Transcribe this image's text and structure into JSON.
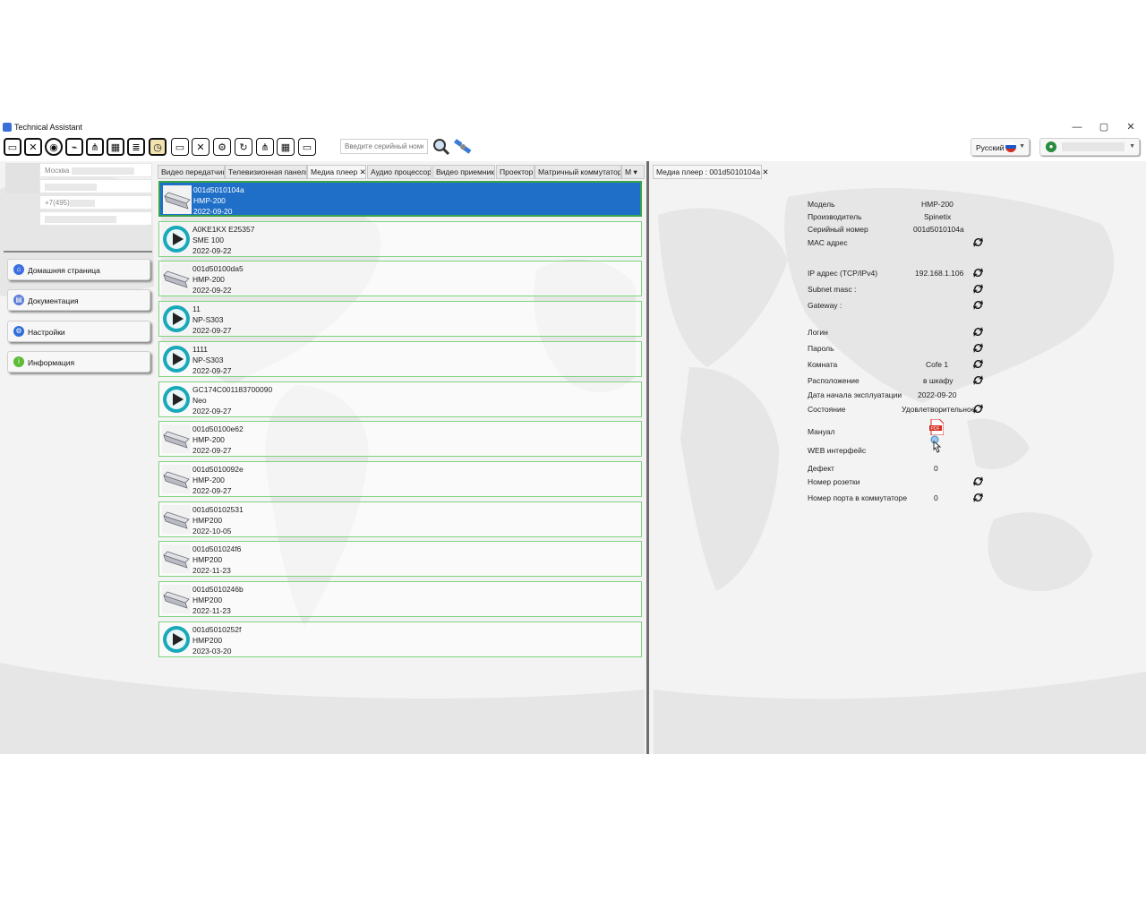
{
  "window": {
    "title": "Technical Assistant",
    "controls": {
      "minimize": "—",
      "maximize": "▢",
      "close": "✕"
    }
  },
  "toolbar": {
    "search_placeholder": "Введите серийный номе",
    "language": "Русский",
    "icons": [
      "display-icon",
      "tools-icon",
      "projector-icon",
      "cable-icon",
      "network-icon",
      "calendar-icon",
      "document-icon",
      "clock-icon",
      "monitor-search-icon",
      "monitor-tools-icon",
      "monitor-settings-icon",
      "monitor-refresh-icon",
      "monitor-network-icon",
      "monitor-calendar-icon",
      "monitor-doc-icon"
    ]
  },
  "left": {
    "fields": [
      "Москва",
      "",
      "+7(495)",
      ""
    ],
    "nav": [
      {
        "label": "Домашняя страница",
        "icon": "home-icon",
        "color": "#3b6fe0"
      },
      {
        "label": "Документация",
        "icon": "document-icon",
        "color": "#5a7bd8"
      },
      {
        "label": "Настройки",
        "icon": "gear-icon",
        "color": "#2f6fd6"
      },
      {
        "label": "Информация",
        "icon": "info-icon",
        "color": "#5dbb3a"
      }
    ]
  },
  "tabs": [
    {
      "label": "Видео передатчик"
    },
    {
      "label": "Телевизионная панель"
    },
    {
      "label": "Медиа плеер ✕",
      "active": true
    },
    {
      "label": "Аудио процессор"
    },
    {
      "label": "Видео приемник"
    },
    {
      "label": "Проектор"
    },
    {
      "label": "Матричный коммутатор"
    },
    {
      "label": "М ▾"
    }
  ],
  "devices": [
    {
      "serial": "001d5010104a",
      "model": "HMP-200",
      "date": "2022-09-20",
      "thumb": "player",
      "selected": true
    },
    {
      "serial": "A0KE1KX E25357",
      "model": "SME 100",
      "date": "2022-09-22",
      "thumb": "play"
    },
    {
      "serial": "001d50100da5",
      "model": "HMP-200",
      "date": "2022-09-22",
      "thumb": "player"
    },
    {
      "serial": "11",
      "model": "NP-S303",
      "date": "2022-09-27",
      "thumb": "play"
    },
    {
      "serial": "1111",
      "model": "NP-S303",
      "date": "2022-09-27",
      "thumb": "play"
    },
    {
      "serial": "GC174C001183700090",
      "model": "Neo",
      "date": "2022-09-27",
      "thumb": "play"
    },
    {
      "serial": "001d50100e62",
      "model": "HMP-200",
      "date": "2022-09-27",
      "thumb": "player"
    },
    {
      "serial": "001d5010092e",
      "model": "HMP-200",
      "date": "2022-09-27",
      "thumb": "player"
    },
    {
      "serial": "001d50102531",
      "model": "HMP200",
      "date": "2022-10-05",
      "thumb": "player"
    },
    {
      "serial": "001d501024f6",
      "model": "HMP200",
      "date": "2022-11-23",
      "thumb": "player"
    },
    {
      "serial": "001d5010246b",
      "model": "HMP200",
      "date": "2022-11-23",
      "thumb": "player"
    },
    {
      "serial": "001d5010252f",
      "model": "HMP200",
      "date": "2023-03-20",
      "thumb": "play"
    }
  ],
  "detail": {
    "tab": "Медиа плеер : 001d5010104a ✕",
    "rows": [
      {
        "label": "Модель",
        "value": "HMP-200",
        "sync": false
      },
      {
        "label": "Производитель",
        "value": "Spinetix",
        "sync": false
      },
      {
        "label": "Серийный номер",
        "value": "001d5010104a",
        "sync": false
      },
      {
        "label": "MAC адрес",
        "value": "",
        "sync": true
      },
      {
        "label": "IP адрес (TCP/IPv4)",
        "value": "192.168.1.106",
        "sync": true
      },
      {
        "label": "Subnet masc :",
        "value": "",
        "sync": true
      },
      {
        "label": "Gateway :",
        "value": "",
        "sync": true
      },
      {
        "label": "Логин",
        "value": "",
        "sync": true
      },
      {
        "label": "Пароль",
        "value": "",
        "sync": true
      },
      {
        "label": "Комната",
        "value": "Cofe 1",
        "sync": true
      },
      {
        "label": "Расположение",
        "value": "в шкафу",
        "sync": true
      },
      {
        "label": "Дата начала эксплуатации",
        "value": "2022-09-20",
        "sync": false
      },
      {
        "label": "Состояние",
        "value": "Удовлетворительное",
        "sync": true
      },
      {
        "label": "Мануал",
        "value": "",
        "sync": false
      },
      {
        "label": "WEB интерфейс",
        "value": "",
        "sync": false
      },
      {
        "label": "Дефект",
        "value": "0",
        "sync": false
      },
      {
        "label": "Номер розетки",
        "value": "",
        "sync": true
      },
      {
        "label": "Номер порта в коммутаторе",
        "value": "0",
        "sync": true
      }
    ]
  },
  "colors": {
    "accent": "#1f6fc8",
    "item_border": "#7fd47f",
    "sync": "#111111"
  }
}
